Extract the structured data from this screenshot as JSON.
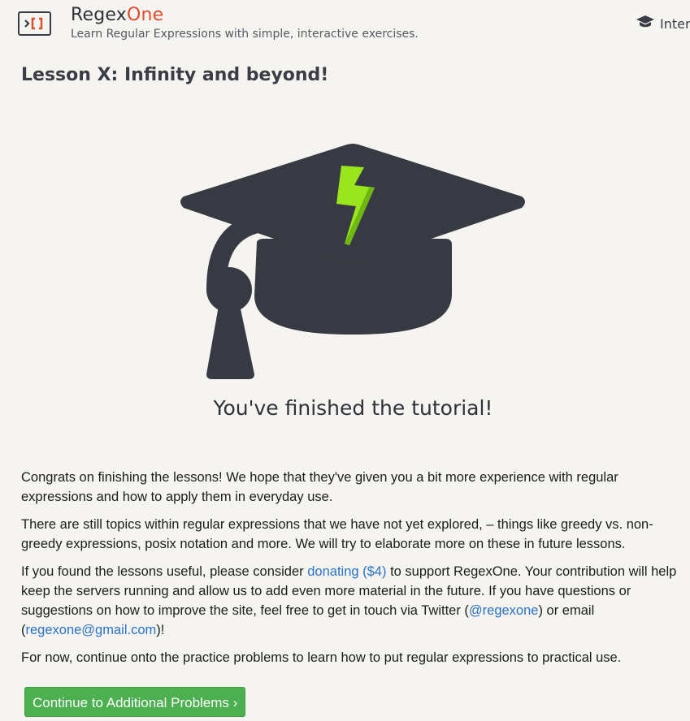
{
  "header": {
    "brand_main": "Regex",
    "brand_accent": "One",
    "tagline": "Learn Regular Expressions with simple, interactive exercises.",
    "nav_label": "Inter",
    "nav_icon": "graduation-cap-icon"
  },
  "lesson": {
    "title": "Lesson X: Infinity and beyond!"
  },
  "hero": {
    "icon": "graduation-cap-lightning-icon",
    "heading": "You've finished the tutorial!"
  },
  "body": {
    "p1": "Congrats on finishing the lessons! We hope that they've given you a bit more experience with regular expressions and how to apply them in everyday use.",
    "p2": "There are still topics within regular expressions that we have not yet explored, – things like greedy vs. non-greedy expressions, posix notation and more. We will try to elaborate more on these in future lessons.",
    "p3_before_donate": "If you found the lessons useful, please consider ",
    "donate_link": "donating ($4)",
    "p3_after_donate": " to support RegexOne. Your contribution will help keep the servers running and allow us to add even more material in the future. If you have questions or suggestions on how to improve the site, feel free to get in touch via Twitter (",
    "twitter_link": "@regexone",
    "p3_mid": ") or email (",
    "email_link": "regexone@gmail.com",
    "p3_end": ")!",
    "p4": "For now, continue onto the practice problems to learn how to put regular expressions to practical use."
  },
  "cta": {
    "label": "Continue to Additional Problems ›"
  },
  "colors": {
    "background": "#f5f4f0",
    "brand_accent": "#e04b2a",
    "cap": "#373a42",
    "bolt": "#9be51f",
    "link": "#2a72c9",
    "button": "#4caf50"
  }
}
